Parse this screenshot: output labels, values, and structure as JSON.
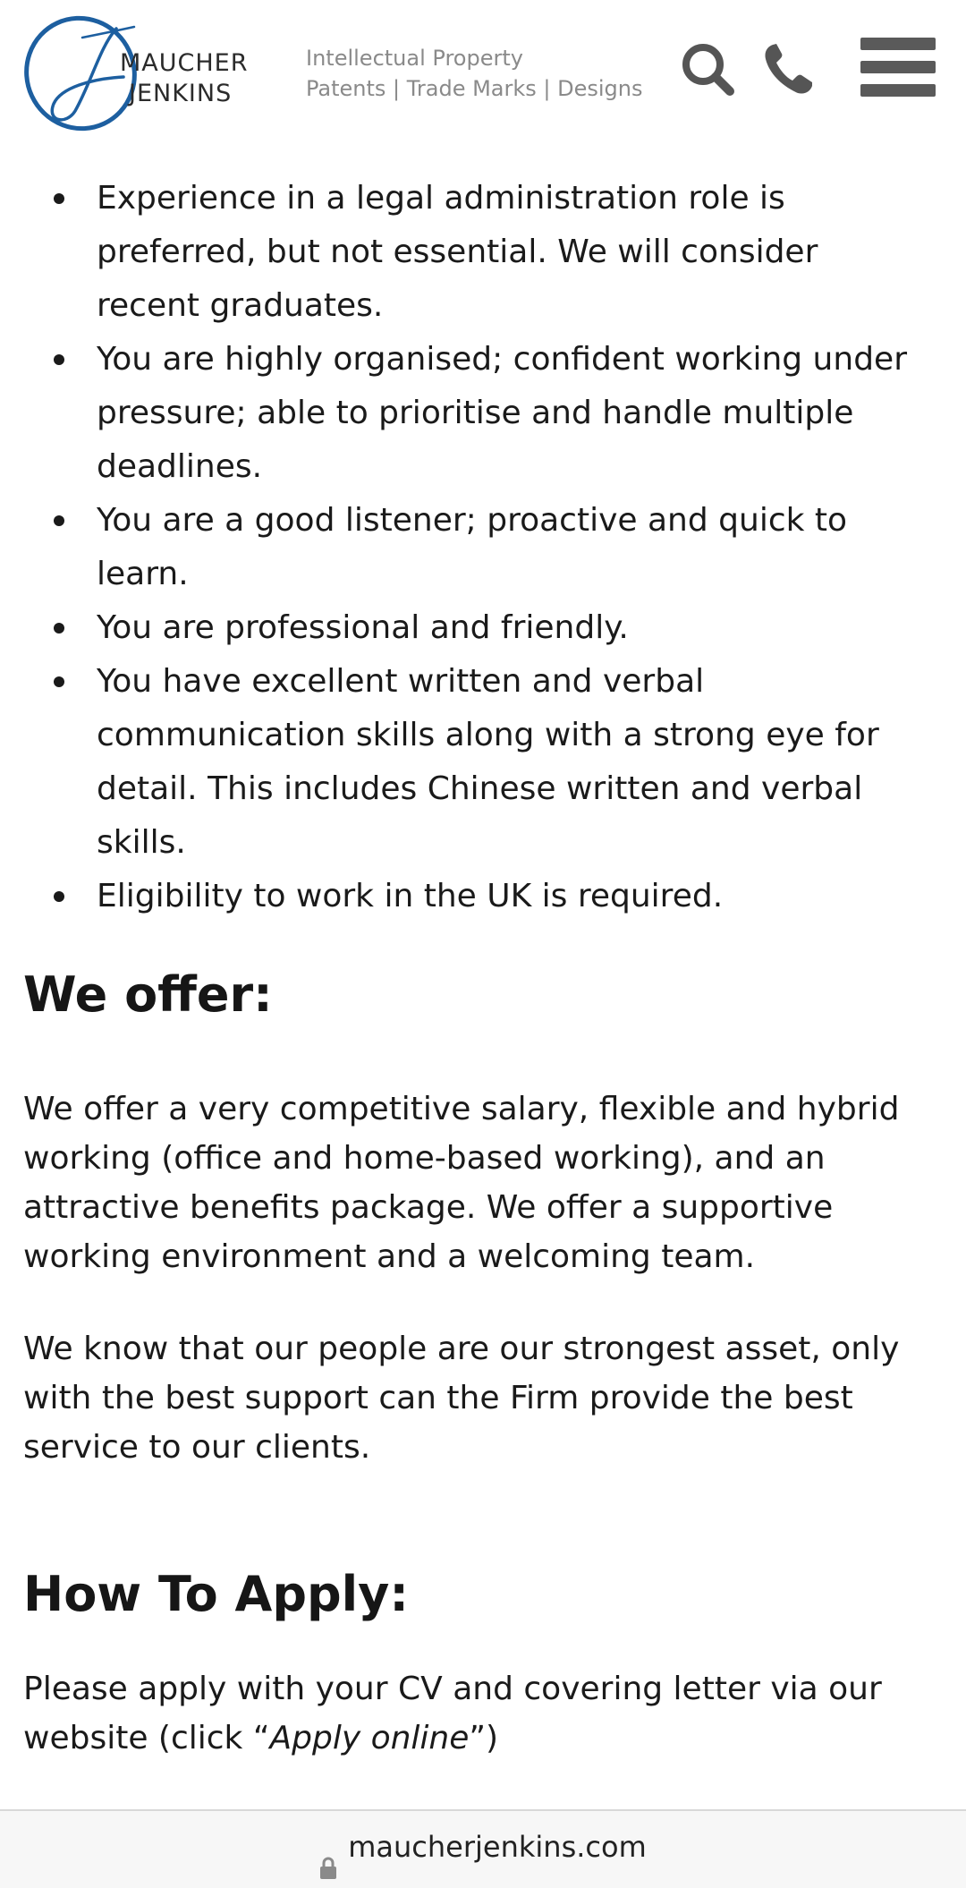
{
  "header": {
    "logo_line1": "MAUCHER",
    "logo_line2": "JENKINS",
    "tagline_line1": "Intellectual Property",
    "tagline_line2": "Patents | Trade Marks | Designs",
    "icons": [
      "search-icon",
      "phone-icon",
      "menu-icon"
    ],
    "brand_color": "#1d5fa0"
  },
  "requirements": [
    "Experience in a legal administration role is preferred, but not essential. We will consider recent graduates.",
    "You are highly organised; confident working under pressure; able to prioritise and handle multiple deadlines.",
    "You are a good listener; proactive and quick to learn.",
    "You are professional and friendly.",
    "You have excellent written and verbal communication skills along with a strong eye for detail. This includes Chinese written and verbal skills.",
    "Eligibility to work in the UK is required."
  ],
  "offer": {
    "heading": "We offer:",
    "para1": "We offer a very competitive salary, flexible and hybrid working (office and home-based working), and an attractive benefits package.  We offer a supportive working environment and a welcoming team.",
    "para2": "We know that our people are our strongest asset, only with the best support can the Firm provide the best service to our clients."
  },
  "apply": {
    "heading": "How To Apply:",
    "text_before": "Please apply with your CV and covering letter via our website (click “",
    "link_text": "Apply online",
    "text_after": "”)"
  },
  "urlbar": {
    "url": "maucherjenkins.com",
    "icon": "lock-icon"
  }
}
